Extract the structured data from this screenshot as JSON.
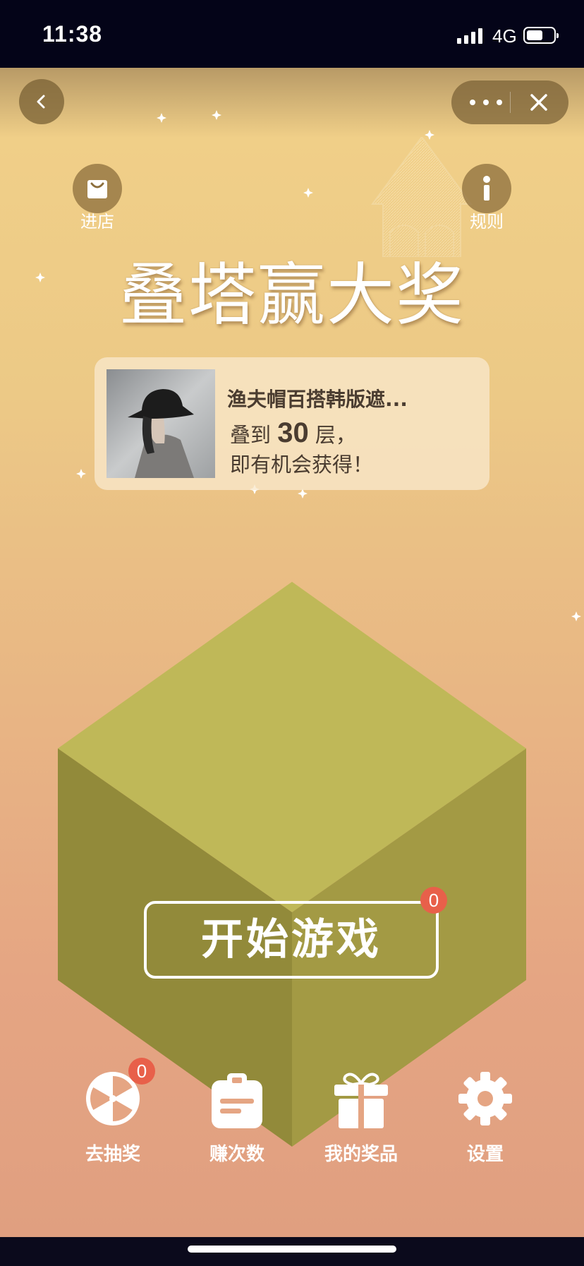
{
  "status_bar": {
    "time": "11:38",
    "network": "4G"
  },
  "top_bar": {
    "back_icon": "chevron-left-icon",
    "more_icon": "more-dots-icon",
    "close_icon": "close-icon"
  },
  "shop": {
    "icon": "shopping-bag-icon",
    "label": "进店"
  },
  "rules": {
    "icon": "info-icon",
    "label": "规则"
  },
  "title": "叠塔赢大奖",
  "prize": {
    "name": "渔夫帽百搭韩版遮...",
    "desc_prefix": "叠到 ",
    "floors": "30",
    "desc_suffix": " 层，",
    "desc_line2": "即有机会获得！"
  },
  "start_button": {
    "label": "开始游戏",
    "badge": "0"
  },
  "nav": [
    {
      "label": "去抽奖",
      "icon": "lottery-wheel-icon",
      "badge": "0"
    },
    {
      "label": "赚次数",
      "icon": "clipboard-icon"
    },
    {
      "label": "我的奖品",
      "icon": "gift-icon"
    },
    {
      "label": "设置",
      "icon": "gear-icon"
    }
  ],
  "colors": {
    "background_top": "#f0cf88",
    "background_bottom": "#e09f80",
    "cube_top": "#bfb858",
    "cube_left": "#928a3a",
    "cube_right": "#a39a44",
    "badge": "#e8604a"
  }
}
